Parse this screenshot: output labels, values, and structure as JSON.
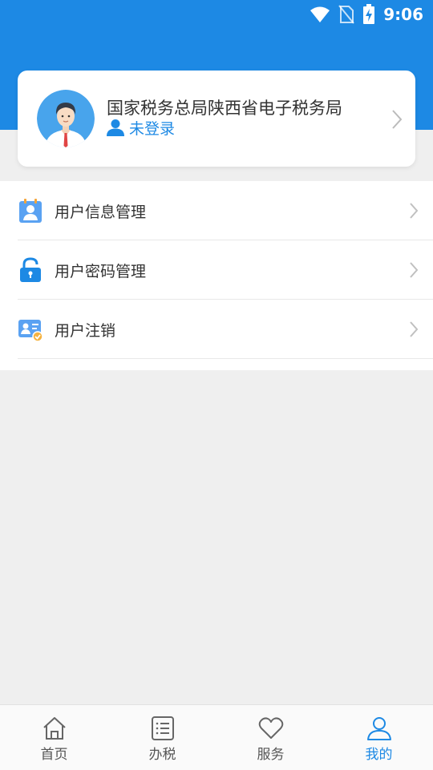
{
  "status_bar": {
    "time": "9:06",
    "icons": [
      "wifi-icon",
      "no-sim-icon",
      "battery-charging-icon"
    ]
  },
  "profile": {
    "org_name": "国家税务总局陕西省电子税务局",
    "login_status": "未登录",
    "avatar_icon": "avatar-man-icon"
  },
  "menu": {
    "items": [
      {
        "label": "用户信息管理",
        "icon": "user-info-icon"
      },
      {
        "label": "用户密码管理",
        "icon": "lock-icon"
      },
      {
        "label": "用户注销",
        "icon": "id-card-icon"
      }
    ]
  },
  "tabbar": {
    "tabs": [
      {
        "label": "首页",
        "icon": "home-icon",
        "active": false
      },
      {
        "label": "办税",
        "icon": "list-icon",
        "active": false
      },
      {
        "label": "服务",
        "icon": "heart-icon",
        "active": false
      },
      {
        "label": "我的",
        "icon": "person-icon",
        "active": true
      }
    ]
  },
  "colors": {
    "accent": "#1d89e4",
    "background": "#efefef",
    "text": "#333333",
    "tab_text": "#555555"
  }
}
